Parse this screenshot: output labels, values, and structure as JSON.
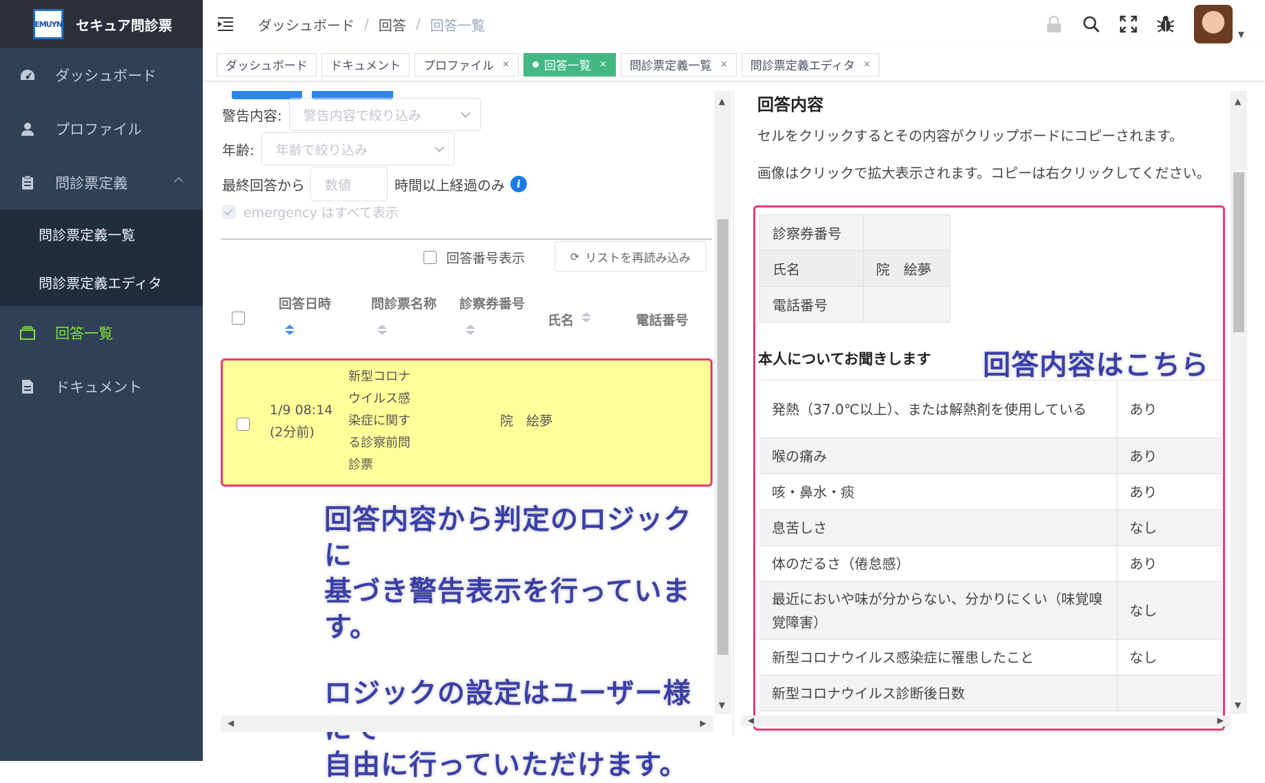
{
  "app": {
    "logo_text": "EMUYN",
    "title": "セキュア問診票"
  },
  "sidebar": {
    "items": [
      {
        "label": "ダッシュボード",
        "icon": "dashboard-icon"
      },
      {
        "label": "プロファイル",
        "icon": "user-icon"
      },
      {
        "label": "問診票定義",
        "icon": "clipboard-icon"
      }
    ],
    "sub_items": [
      {
        "label": "問診票定義一覧"
      },
      {
        "label": "問診票定義エディタ"
      }
    ],
    "items_after": [
      {
        "label": "回答一覧",
        "icon": "list-icon",
        "active": true
      },
      {
        "label": "ドキュメント",
        "icon": "document-icon"
      }
    ],
    "active_color": "#7ee23a",
    "bg_color": "#304156"
  },
  "breadcrumb": [
    "ダッシュボード",
    "回答",
    "回答一覧"
  ],
  "breadcrumb_sep": "/",
  "tags": [
    {
      "label": "ダッシュボード",
      "closable": false
    },
    {
      "label": "ドキュメント",
      "closable": false
    },
    {
      "label": "プロファイル",
      "closable": true
    },
    {
      "label": "回答一覧",
      "closable": true,
      "active": true
    },
    {
      "label": "問診票定義一覧",
      "closable": true
    },
    {
      "label": "問診票定義エディタ",
      "closable": true
    }
  ],
  "tag_close": "×",
  "filters": {
    "warning_label": "警告内容:",
    "warning_placeholder": "警告内容で絞り込み",
    "age_label": "年齢:",
    "age_placeholder": "年齢で絞り込み",
    "last_answer_label": "最終回答から",
    "hours_placeholder": "数値",
    "hours_suffix": "時間以上経過のみ",
    "info": "i",
    "emergency_label": "emergency はすべて表示",
    "show_number_label": "回答番号表示",
    "reload_label": "リストを再読み込み"
  },
  "table": {
    "headers": [
      "回答日時",
      "問診票名称",
      "診察券番号",
      "氏名",
      "電話番号"
    ],
    "rows": [
      {
        "datetime": "1/9 08:14",
        "relative": "(2分前)",
        "form_name": [
          "新型コロナ",
          "ウイルス感",
          "染症に関す",
          "る診察前問",
          "診票"
        ],
        "patient_no": "",
        "name": "院　絵夢",
        "phone": ""
      }
    ],
    "highlight_color": "#ffff99"
  },
  "annotations": {
    "left": [
      "回答内容から判定のロジックに",
      "基づき警告表示を行っています。",
      "",
      "ロジックの設定はユーザー様にて",
      "自由に行っていただけます。"
    ],
    "right": "回答内容はこちら"
  },
  "detail": {
    "title": "回答内容",
    "desc1": "セルをクリックするとその内容がクリップボードにコピーされます。",
    "desc2": "画像はクリックで拡大表示されます。コピーは右クリックしてください。",
    "patient_info": [
      {
        "label": "診察券番号",
        "value": ""
      },
      {
        "label": "氏名",
        "value": "院　絵夢"
      },
      {
        "label": "電話番号",
        "value": ""
      }
    ],
    "section_title": "本人についてお聞きします",
    "qa": [
      {
        "q": "発熱（37.0℃以上）、または解熱剤を使用している",
        "a": "あり"
      },
      {
        "q": "喉の痛み",
        "a": "あり"
      },
      {
        "q": "咳・鼻水・痰",
        "a": "あり"
      },
      {
        "q": "息苦しさ",
        "a": "なし"
      },
      {
        "q": "体のだるさ（倦怠感）",
        "a": "あり"
      },
      {
        "q": "最近においや味が分からない、分かりにくい（味覚嗅覚障害）",
        "a": "なし"
      },
      {
        "q": "新型コロナウイルス感染症に罹患したこと",
        "a": "なし"
      },
      {
        "q": "新型コロナウイルス診断後日数",
        "a": ""
      }
    ]
  },
  "accent_color": "#e83a6d",
  "annotation_color": "#3a3fa8"
}
